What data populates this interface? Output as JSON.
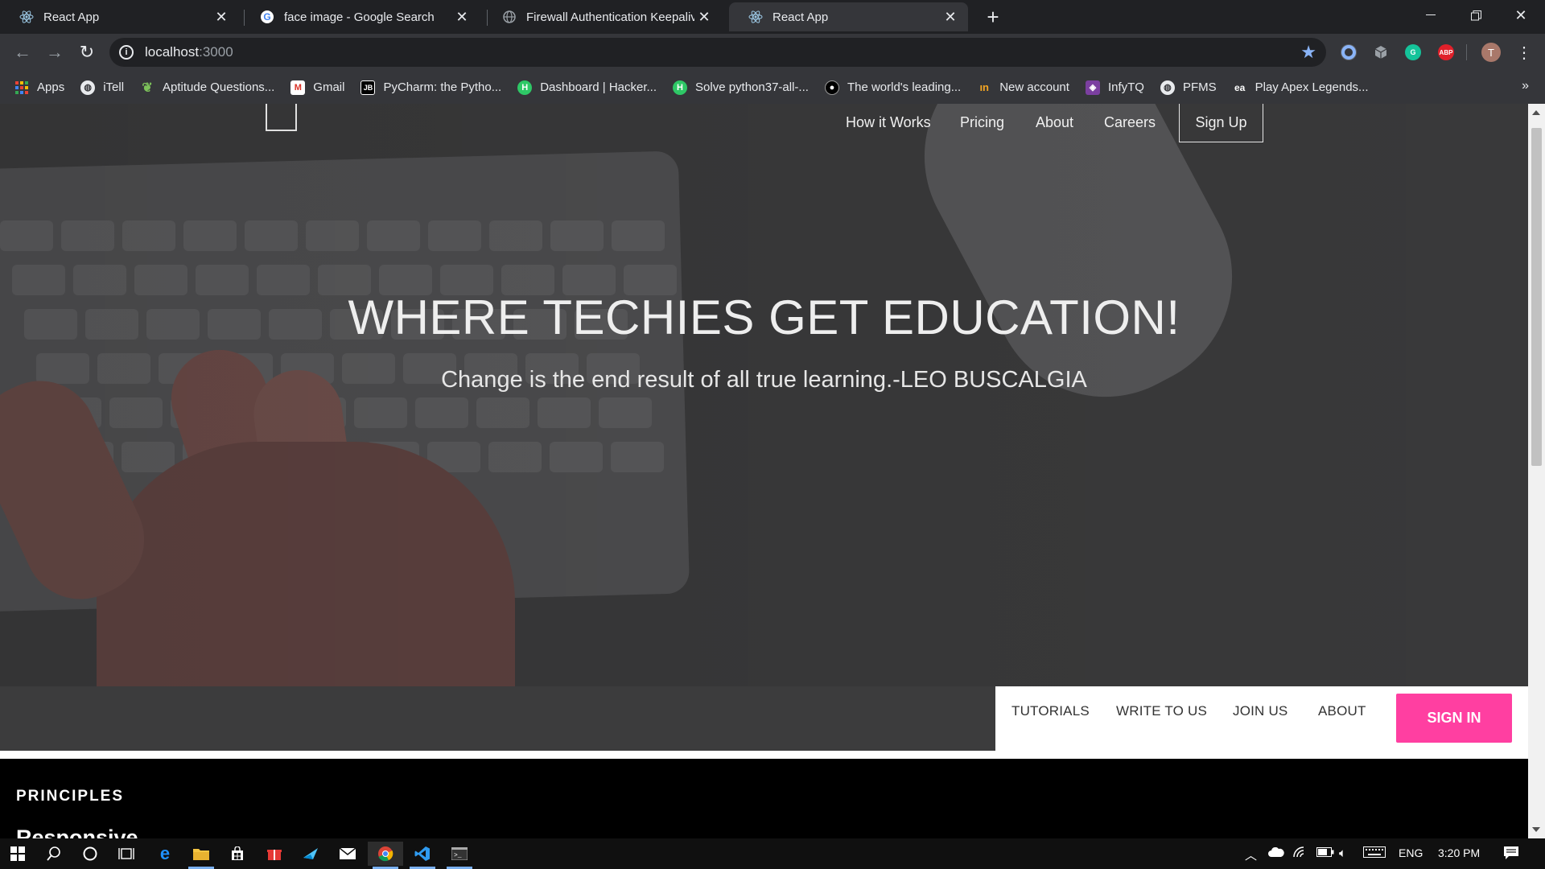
{
  "browser": {
    "tabs": [
      {
        "title": "React App",
        "favicon": "react-icon",
        "active": false
      },
      {
        "title": "face image - Google Search",
        "favicon": "google-icon",
        "active": false
      },
      {
        "title": "Firewall Authentication Keepalive",
        "favicon": "globe-icon",
        "active": false
      },
      {
        "title": "React App",
        "favicon": "react-icon",
        "active": true
      }
    ],
    "address": {
      "host": "localhost",
      "port": ":3000"
    },
    "bookmarks": [
      {
        "label": "Apps",
        "icon": "apps-grid-icon"
      },
      {
        "label": "iTell",
        "icon": "globe-icon"
      },
      {
        "label": "Aptitude Questions...",
        "icon": "leaf-icon"
      },
      {
        "label": "Gmail",
        "icon": "gmail-icon"
      },
      {
        "label": "PyCharm: the Pytho...",
        "icon": "jetbrains-icon"
      },
      {
        "label": "Dashboard | Hacker...",
        "icon": "hackerrank-icon"
      },
      {
        "label": "Solve python37-all-...",
        "icon": "hackerrank-icon"
      },
      {
        "label": "The world's leading...",
        "icon": "github-icon"
      },
      {
        "label": "New account",
        "icon": "new-account-icon"
      },
      {
        "label": "InfyTQ",
        "icon": "infytq-icon"
      },
      {
        "label": "PFMS",
        "icon": "globe-icon"
      },
      {
        "label": "Play Apex Legends...",
        "icon": "ea-icon"
      }
    ],
    "profile_initial": "T",
    "ext_abp": "ABP"
  },
  "site": {
    "nav": {
      "how_it_works": "How it Works",
      "pricing": "Pricing",
      "about": "About",
      "careers": "Careers",
      "sign_up": "Sign Up"
    },
    "hero": {
      "title": "WHERE TECHIES GET EDUCATION!",
      "subtitle": "Change is the end result of all true learning.-LEO BUSCALGIA"
    },
    "subnav": {
      "tutorials": "TUTORIALS",
      "write_to_us": "WRITE TO US",
      "join_us": "JOIN US",
      "about": "ABOUT",
      "sign_in": "SIGN IN"
    },
    "principles": {
      "heading": "PRINCIPLES",
      "first_item": "Responsive"
    },
    "colors": {
      "accent": "#ff3fa1",
      "hero_bg": "#3a3a3b"
    }
  },
  "taskbar": {
    "language": "ENG",
    "time": "3:20 PM"
  }
}
